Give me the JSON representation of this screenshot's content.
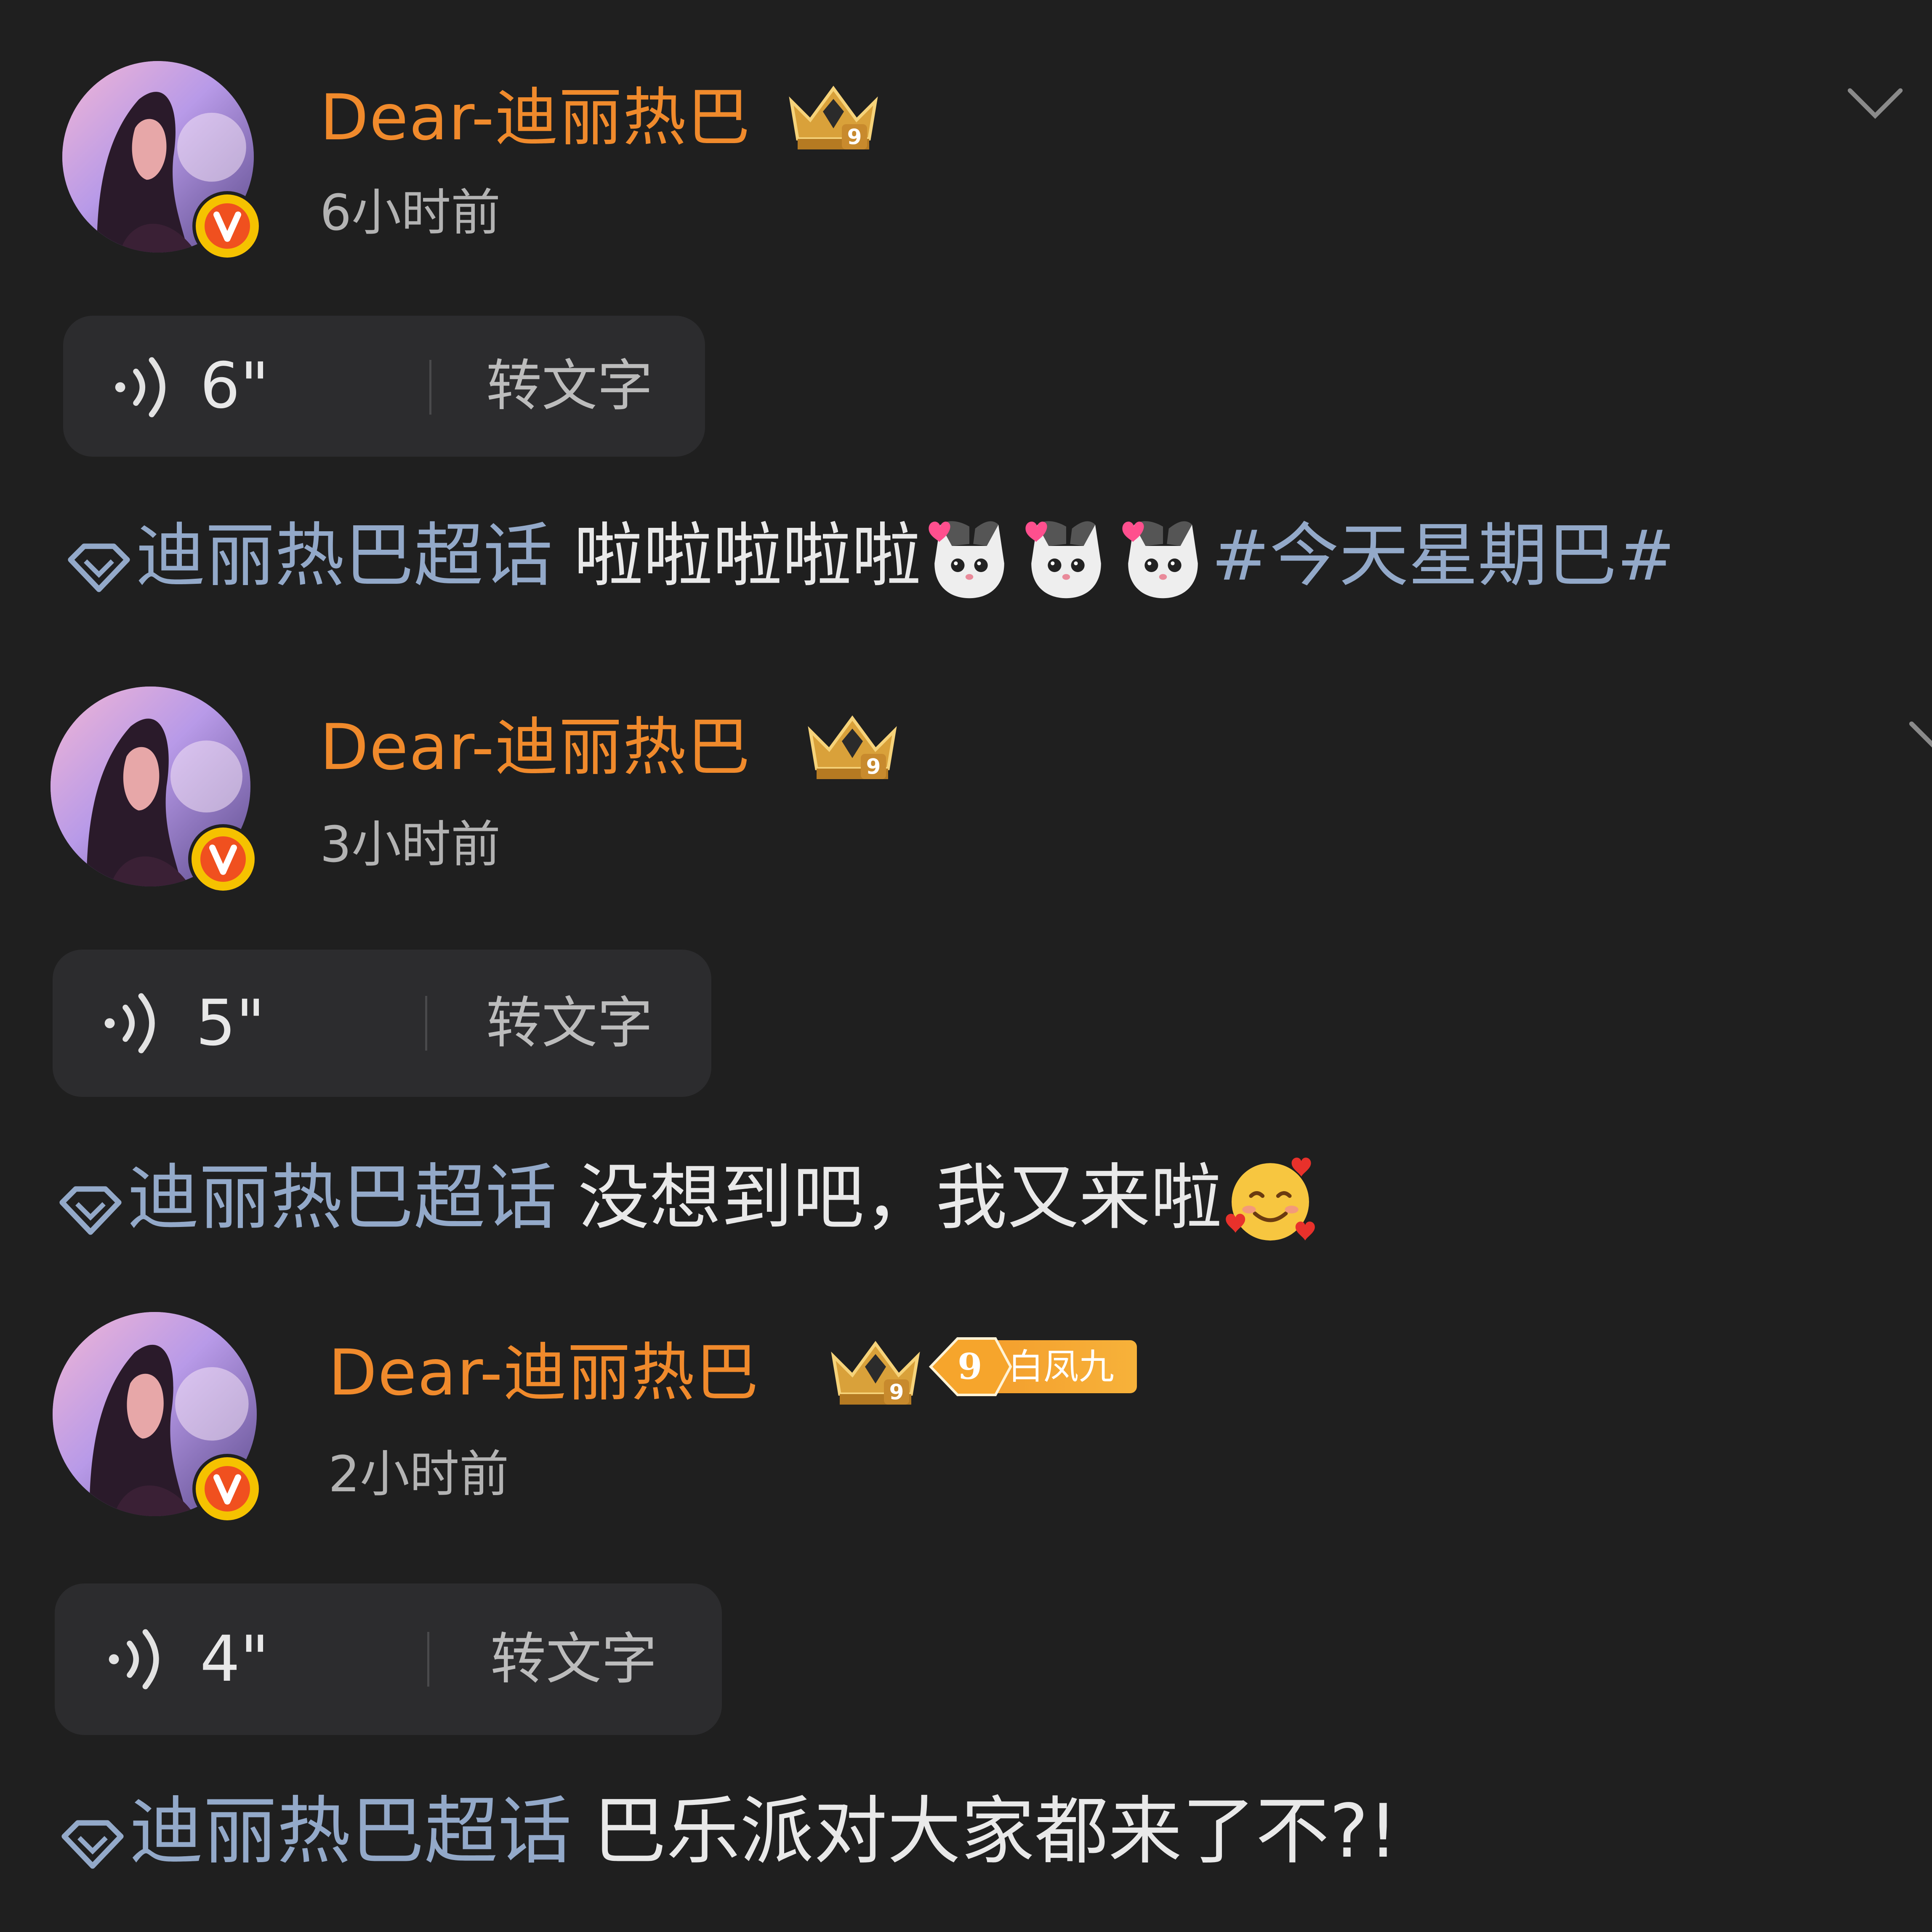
{
  "colors": {
    "background": "#1f1f1f",
    "username": "#f08a2c",
    "time": "#b3b3b3",
    "card": "#2c2c2e",
    "topic": "#93a9c9",
    "text": "#e9e9e9",
    "verified": "#f5c200"
  },
  "posts": [
    {
      "username": "Dear-迪丽热巴",
      "time": "6小时前",
      "avatar_icon": "avatar-photo",
      "verified_icon": "verified-v-icon",
      "crown_icon": "crown-level-9-icon",
      "voice": {
        "duration": "6\"",
        "to_text_label": "转文字"
      },
      "topic": "迪丽热巴超话",
      "text": "啦啦啦啦啦",
      "emojis": [
        "cat-heart-emoji",
        "cat-heart-emoji",
        "cat-heart-emoji"
      ],
      "hashtag": "#今天星期巴#",
      "has_menu": true
    },
    {
      "username": "Dear-迪丽热巴",
      "time": "3小时前",
      "avatar_icon": "avatar-photo",
      "verified_icon": "verified-v-icon",
      "crown_icon": "crown-level-9-icon",
      "voice": {
        "duration": "5\"",
        "to_text_label": "转文字"
      },
      "topic": "迪丽热巴超话",
      "text": "没想到吧，我又来啦",
      "emojis": [
        "smiling-face-with-hearts-emoji"
      ],
      "has_menu": true
    },
    {
      "username": "Dear-迪丽热巴",
      "time": "2小时前",
      "avatar_icon": "avatar-photo",
      "verified_icon": "verified-v-icon",
      "crown_icon": "crown-level-9-icon",
      "badge": {
        "level": "9",
        "label": "白凤九"
      },
      "voice": {
        "duration": "4\"",
        "to_text_label": "转文字"
      },
      "topic": "迪丽热巴超话",
      "text": "巴乐派对大家都来了不?!",
      "has_menu": false
    }
  ]
}
